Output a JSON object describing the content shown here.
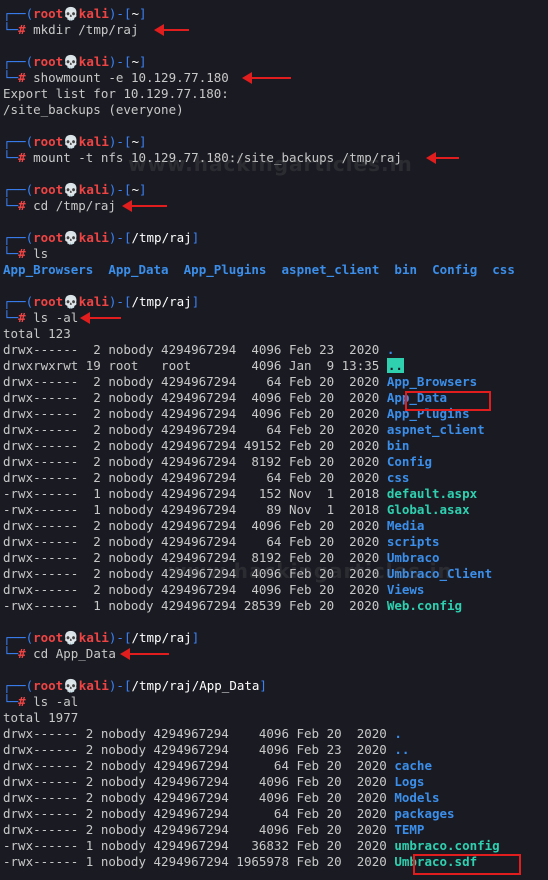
{
  "prompt": {
    "user": "root",
    "host": "kali",
    "skull": "💀",
    "hash": "#"
  },
  "blocks": [
    {
      "dir": "~",
      "cmd": "mkdir /tmp/raj"
    },
    {
      "dir": "~",
      "cmd": "showmount -e 10.129.77.180",
      "output": [
        "Export list for 10.129.77.180:",
        "/site_backups (everyone)"
      ]
    },
    {
      "dir": "~",
      "cmd": "mount -t nfs 10.129.77.180:/site_backups /tmp/raj"
    },
    {
      "dir": "~",
      "cmd": "cd /tmp/raj"
    },
    {
      "dir": "/tmp/raj",
      "cmd": "ls"
    },
    {
      "dir": "/tmp/raj",
      "cmd": "ls -al"
    },
    {
      "dir": "/tmp/raj",
      "cmd": "cd App_Data"
    },
    {
      "dir": "/tmp/raj/App_Data",
      "cmd": "ls -al"
    }
  ],
  "ls_output": [
    "App_Browsers",
    "App_Data",
    "App_Plugins",
    "aspnet_client",
    "bin",
    "Config",
    "css"
  ],
  "listing1_total": "total 123",
  "listing1": [
    {
      "perm": "drwx------",
      "links": " 2",
      "owner": "nobody",
      "group": "4294967294",
      "size": " 4096",
      "date": "Feb 23  2020",
      "name": ".",
      "kind": "dir"
    },
    {
      "perm": "drwxrwxrwt",
      "links": "19",
      "owner": "root  ",
      "group": "root      ",
      "size": " 4096",
      "date": "Jan  9 13:35",
      "name": "..",
      "kind": "dotdot"
    },
    {
      "perm": "drwx------",
      "links": " 2",
      "owner": "nobody",
      "group": "4294967294",
      "size": "   64",
      "date": "Feb 20  2020",
      "name": "App_Browsers",
      "kind": "dir"
    },
    {
      "perm": "drwx------",
      "links": " 2",
      "owner": "nobody",
      "group": "4294967294",
      "size": " 4096",
      "date": "Feb 20  2020",
      "name": "App_Data",
      "kind": "dir"
    },
    {
      "perm": "drwx------",
      "links": " 2",
      "owner": "nobody",
      "group": "4294967294",
      "size": " 4096",
      "date": "Feb 20  2020",
      "name": "App_Plugins",
      "kind": "dir"
    },
    {
      "perm": "drwx------",
      "links": " 2",
      "owner": "nobody",
      "group": "4294967294",
      "size": "   64",
      "date": "Feb 20  2020",
      "name": "aspnet_client",
      "kind": "dir"
    },
    {
      "perm": "drwx------",
      "links": " 2",
      "owner": "nobody",
      "group": "4294967294",
      "size": "49152",
      "date": "Feb 20  2020",
      "name": "bin",
      "kind": "dir"
    },
    {
      "perm": "drwx------",
      "links": " 2",
      "owner": "nobody",
      "group": "4294967294",
      "size": " 8192",
      "date": "Feb 20  2020",
      "name": "Config",
      "kind": "dir"
    },
    {
      "perm": "drwx------",
      "links": " 2",
      "owner": "nobody",
      "group": "4294967294",
      "size": "   64",
      "date": "Feb 20  2020",
      "name": "css",
      "kind": "dir"
    },
    {
      "perm": "-rwx------",
      "links": " 1",
      "owner": "nobody",
      "group": "4294967294",
      "size": "  152",
      "date": "Nov  1  2018",
      "name": "default.aspx",
      "kind": "file"
    },
    {
      "perm": "-rwx------",
      "links": " 1",
      "owner": "nobody",
      "group": "4294967294",
      "size": "   89",
      "date": "Nov  1  2018",
      "name": "Global.asax",
      "kind": "file"
    },
    {
      "perm": "drwx------",
      "links": " 2",
      "owner": "nobody",
      "group": "4294967294",
      "size": " 4096",
      "date": "Feb 20  2020",
      "name": "Media",
      "kind": "dir"
    },
    {
      "perm": "drwx------",
      "links": " 2",
      "owner": "nobody",
      "group": "4294967294",
      "size": "   64",
      "date": "Feb 20  2020",
      "name": "scripts",
      "kind": "dir"
    },
    {
      "perm": "drwx------",
      "links": " 2",
      "owner": "nobody",
      "group": "4294967294",
      "size": " 8192",
      "date": "Feb 20  2020",
      "name": "Umbraco",
      "kind": "dir"
    },
    {
      "perm": "drwx------",
      "links": " 2",
      "owner": "nobody",
      "group": "4294967294",
      "size": " 4096",
      "date": "Feb 20  2020",
      "name": "Umbraco_Client",
      "kind": "dir"
    },
    {
      "perm": "drwx------",
      "links": " 2",
      "owner": "nobody",
      "group": "4294967294",
      "size": " 4096",
      "date": "Feb 20  2020",
      "name": "Views",
      "kind": "dir"
    },
    {
      "perm": "-rwx------",
      "links": " 1",
      "owner": "nobody",
      "group": "4294967294",
      "size": "28539",
      "date": "Feb 20  2020",
      "name": "Web.config",
      "kind": "file"
    }
  ],
  "listing2_total": "total 1977",
  "listing2": [
    {
      "perm": "drwx------",
      "links": "2",
      "owner": "nobody",
      "group": "4294967294",
      "size": "   4096",
      "date": "Feb 20  2020",
      "name": ".",
      "kind": "dir"
    },
    {
      "perm": "drwx------",
      "links": "2",
      "owner": "nobody",
      "group": "4294967294",
      "size": "   4096",
      "date": "Feb 23  2020",
      "name": "..",
      "kind": "dir"
    },
    {
      "perm": "drwx------",
      "links": "2",
      "owner": "nobody",
      "group": "4294967294",
      "size": "     64",
      "date": "Feb 20  2020",
      "name": "cache",
      "kind": "dir"
    },
    {
      "perm": "drwx------",
      "links": "2",
      "owner": "nobody",
      "group": "4294967294",
      "size": "   4096",
      "date": "Feb 20  2020",
      "name": "Logs",
      "kind": "dir"
    },
    {
      "perm": "drwx------",
      "links": "2",
      "owner": "nobody",
      "group": "4294967294",
      "size": "   4096",
      "date": "Feb 20  2020",
      "name": "Models",
      "kind": "dir"
    },
    {
      "perm": "drwx------",
      "links": "2",
      "owner": "nobody",
      "group": "4294967294",
      "size": "     64",
      "date": "Feb 20  2020",
      "name": "packages",
      "kind": "dir"
    },
    {
      "perm": "drwx------",
      "links": "2",
      "owner": "nobody",
      "group": "4294967294",
      "size": "   4096",
      "date": "Feb 20  2020",
      "name": "TEMP",
      "kind": "dir"
    },
    {
      "perm": "-rwx------",
      "links": "1",
      "owner": "nobody",
      "group": "4294967294",
      "size": "  36832",
      "date": "Feb 20  2020",
      "name": "umbraco.config",
      "kind": "file"
    },
    {
      "perm": "-rwx------",
      "links": "1",
      "owner": "nobody",
      "group": "4294967294",
      "size": "1965978",
      "date": "Feb 20  2020",
      "name": "Umbraco.sdf",
      "kind": "file"
    }
  ],
  "watermark": "www.hackingarticles.in",
  "colors": {
    "background": "#1a1b22",
    "prompt_frame": "#3b82f6",
    "prompt_user": "#ef4444",
    "dir": "#3b8eea",
    "file": "#2fd0b0",
    "annotation": "#e11d1d"
  }
}
